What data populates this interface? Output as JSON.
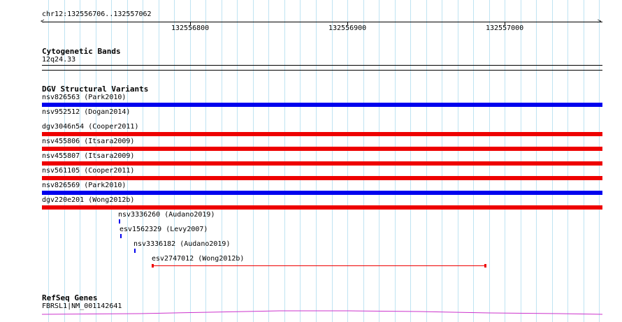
{
  "ruler": {
    "location": "chr12:132556706..132557062",
    "labels": [
      {
        "text": "132556800",
        "pos": 132556800
      },
      {
        "text": "132556900",
        "pos": 132556900
      },
      {
        "text": "132557000",
        "pos": 132557000
      }
    ]
  },
  "genome": {
    "start": 132556706,
    "end": 132557062
  },
  "tracks": {
    "cytoband": {
      "title": "Cytogenetic Bands",
      "band": "12q24.33"
    },
    "dgv": {
      "title": "DGV Structural Variants",
      "variants": [
        {
          "label": "nsv826563 (Park2010)",
          "color": "#0000ee",
          "type": "loss"
        },
        {
          "label": "nsv952512 (Dogan2014)",
          "color": "#ee0000",
          "type": "gain-thin"
        },
        {
          "label": "dgv3046n54 (Cooper2011)",
          "color": "#ee0000",
          "type": "gain"
        },
        {
          "label": "nsv455806 (Itsara2009)",
          "color": "#ee0000",
          "type": "gain"
        },
        {
          "label": "nsv455807 (Itsara2009)",
          "color": "#ee0000",
          "type": "gain"
        },
        {
          "label": "nsv561105 (Cooper2011)",
          "color": "#ee0000",
          "type": "gain"
        },
        {
          "label": "nsv826569 (Park2010)",
          "color": "#0000ee",
          "type": "loss"
        },
        {
          "label": "dgv220e201 (Wong2012b)",
          "color": "#ee0000",
          "type": "gain"
        }
      ],
      "small_variants": [
        {
          "label": "nsv3336260 (Audano2019)",
          "color": "#0000ee"
        },
        {
          "label": "esv1562329 (Levy2007)",
          "color": "#0000ee"
        },
        {
          "label": "nsv3336182 (Audano2019)",
          "color": "#0000ee"
        },
        {
          "label": "esv2747012 (Wong2012b)",
          "color": "#ee0000"
        }
      ]
    },
    "refseq": {
      "title": "RefSeq Genes",
      "gene": "FBRSL1|NM_001142641",
      "color": "#cc33cc"
    }
  }
}
